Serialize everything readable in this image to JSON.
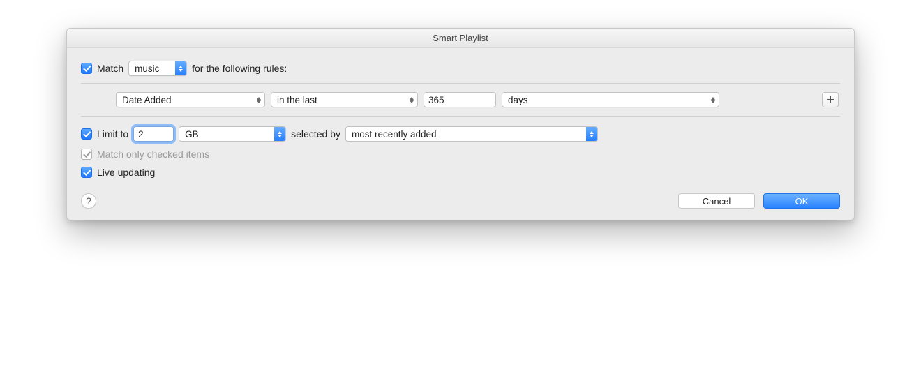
{
  "title": "Smart Playlist",
  "match": {
    "label": "Match",
    "media_type": "music",
    "suffix": "for the following rules:"
  },
  "rule": {
    "field": "Date Added",
    "operator": "in the last",
    "value": "365",
    "unit": "days"
  },
  "limit": {
    "label": "Limit to",
    "value": "2",
    "unit": "GB",
    "selected_by_label": "selected by",
    "selected_by": "most recently added"
  },
  "match_only_checked": {
    "label": "Match only checked items"
  },
  "live_updating": {
    "label": "Live updating"
  },
  "help_glyph": "?",
  "plus_glyph": "＋",
  "buttons": {
    "cancel": "Cancel",
    "ok": "OK"
  }
}
